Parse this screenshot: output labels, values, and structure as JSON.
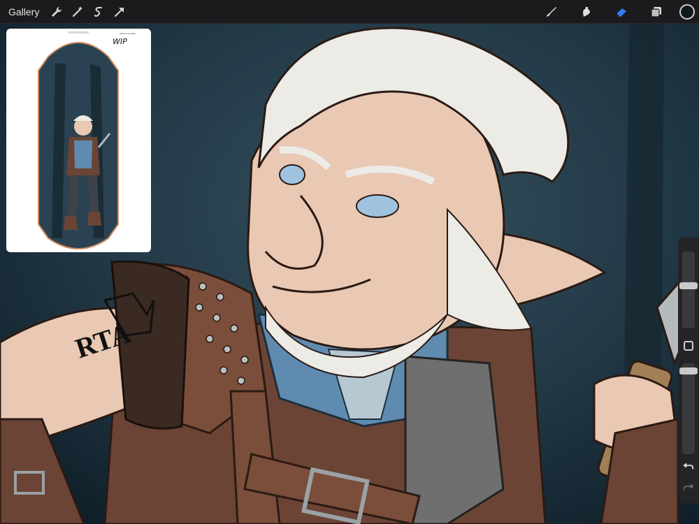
{
  "toolbar": {
    "gallery_label": "Gallery",
    "left_tools": [
      {
        "name": "actions-icon"
      },
      {
        "name": "adjustments-icon"
      },
      {
        "name": "selection-icon"
      },
      {
        "name": "transform-icon"
      }
    ],
    "right_tools": [
      {
        "name": "brush-icon",
        "active": false
      },
      {
        "name": "smudge-icon",
        "active": false
      },
      {
        "name": "eraser-icon",
        "active": true
      },
      {
        "name": "layers-icon",
        "active": false
      }
    ],
    "active_color": "#11181d",
    "accent_color": "#2f7df6"
  },
  "reference": {
    "tag": "WIP",
    "url": "patreon.com/kaiu"
  },
  "artwork": {
    "tattoo_text": "RTA"
  },
  "sidebar": {
    "brush_size": 0.2,
    "opacity": 0.15,
    "undo_icon": "undo-icon",
    "redo_icon": "redo-icon"
  }
}
